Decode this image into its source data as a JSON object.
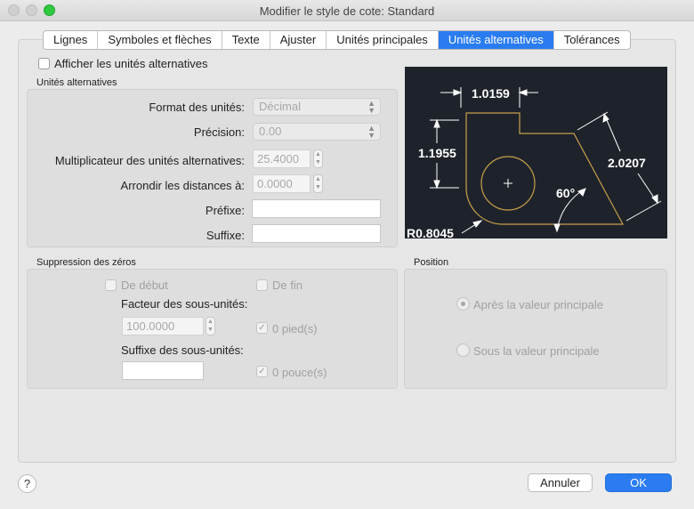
{
  "window": {
    "title": "Modifier le style de cote: Standard"
  },
  "tabs": [
    {
      "label": "Lignes"
    },
    {
      "label": "Symboles et flèches"
    },
    {
      "label": "Texte"
    },
    {
      "label": "Ajuster"
    },
    {
      "label": "Unités principales"
    },
    {
      "label": "Unités alternatives",
      "active": true
    },
    {
      "label": "Tolérances"
    }
  ],
  "show_alt": {
    "label": "Afficher les unités alternatives",
    "checked": false
  },
  "alt_units": {
    "title": "Unités alternatives",
    "format": {
      "label": "Format des unités:",
      "value": "Décimal"
    },
    "precision": {
      "label": "Précision:",
      "value": "0.00"
    },
    "multiplier": {
      "label": "Multiplicateur des unités alternatives:",
      "value": "25.4000"
    },
    "round": {
      "label": "Arrondir les distances à:",
      "value": "0.0000"
    },
    "prefix": {
      "label": "Préfixe:",
      "value": ""
    },
    "suffix": {
      "label": "Suffixe:",
      "value": ""
    }
  },
  "zero_suppression": {
    "title": "Suppression des zéros",
    "leading": {
      "label": "De début",
      "checked": false
    },
    "trailing": {
      "label": "De fin",
      "checked": false
    },
    "sub_factor": {
      "label": "Facteur des sous-unités:",
      "value": "100.0000"
    },
    "feet": {
      "label": "0 pied(s)",
      "checked": true
    },
    "sub_suffix": {
      "label": "Suffixe des sous-unités:",
      "value": ""
    },
    "inches": {
      "label": "0 pouce(s)",
      "checked": true
    }
  },
  "position": {
    "title": "Position",
    "after": {
      "label": "Après la valeur principale",
      "selected": true
    },
    "below": {
      "label": "Sous la valeur principale",
      "selected": false
    }
  },
  "preview": {
    "dim_top": "1.0159",
    "dim_left": "1.1955",
    "dim_diag": "2.0207",
    "angle": "60°",
    "radius": "R0.8045"
  },
  "buttons": {
    "help": "?",
    "cancel": "Annuler",
    "ok": "OK"
  },
  "colors": {
    "accent": "#2a7cf0",
    "preview_bg": "#1e232b",
    "geometry": "#c8a04a",
    "dim_lines": "#ffffff"
  }
}
